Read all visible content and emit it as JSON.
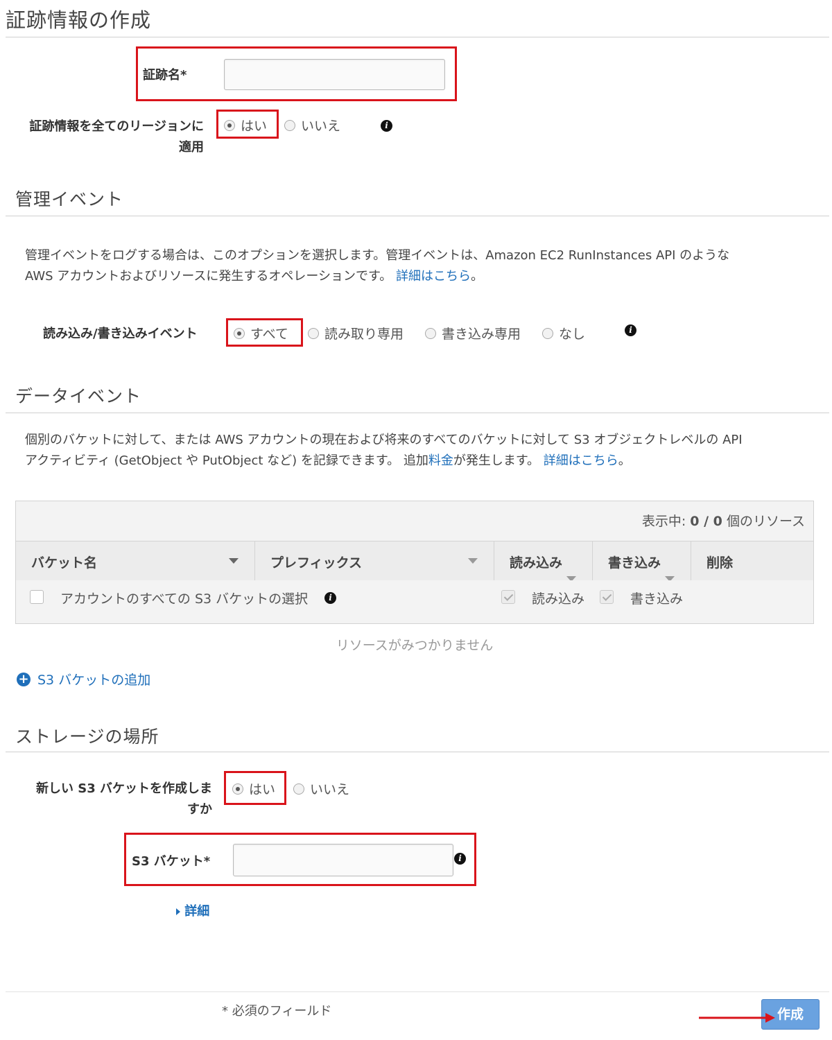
{
  "page": {
    "title": "証跡情報の作成"
  },
  "trail": {
    "name_label": "証跡名*",
    "name_value": "",
    "apply_all_regions_label_1": "証跡情報を全てのリージョンに",
    "apply_all_regions_label_2": "適用",
    "yes": "はい",
    "no": "いいえ",
    "selected": "はい"
  },
  "management": {
    "title": "管理イベント",
    "desc_line1": "管理イベントをログする場合は、このオプションを選択します。管理イベントは、Amazon EC2 RunInstances API のような",
    "desc_line2": "AWS アカウントおよびリソースに発生するオペレーションです。",
    "learn_more": "詳細はこちら",
    "period": "。",
    "rw_label": "読み込み/書き込みイベント",
    "options": [
      "すべて",
      "読み取り専用",
      "書き込み専用",
      "なし"
    ],
    "selected": "すべて"
  },
  "data_events": {
    "title": "データイベント",
    "desc_line1": "個別のバケットに対して、または AWS アカウントの現在および将来のすべてのバケットに対して S3 オブジェクトレベルの API",
    "desc_line2_a": "アクティビティ (GetObject や PutObject など) を記録できます。 追加",
    "pricing_link": "料金",
    "desc_line2_b": "が発生します。",
    "learn_more": "詳細はこちら",
    "period": "。",
    "table": {
      "showing_prefix": "表示中: ",
      "showing_count": "0 / 0",
      "showing_suffix": " 個のリソース",
      "columns": [
        "バケット名",
        "プレフィックス",
        "読み込み",
        "書き込み",
        "削除"
      ],
      "select_all_label": "アカウントのすべての S3 バケットの選択",
      "read_label": "読み込み",
      "write_label": "書き込み",
      "empty_text": "リソースがみつかりません"
    },
    "add_bucket": "S3 バケットの追加"
  },
  "storage": {
    "title": "ストレージの場所",
    "new_bucket_label_1": "新しい S3 バケットを作成しま",
    "new_bucket_label_2": "すか",
    "yes": "はい",
    "no": "いいえ",
    "selected": "はい",
    "bucket_label": "S3 バケット*",
    "bucket_value": "",
    "details": "詳細"
  },
  "footer": {
    "required_note": "* 必須のフィールド",
    "create_button": "作成"
  },
  "colors": {
    "highlight": "#d9141b",
    "link": "#1f6fba",
    "button": "#6aa2e0"
  }
}
